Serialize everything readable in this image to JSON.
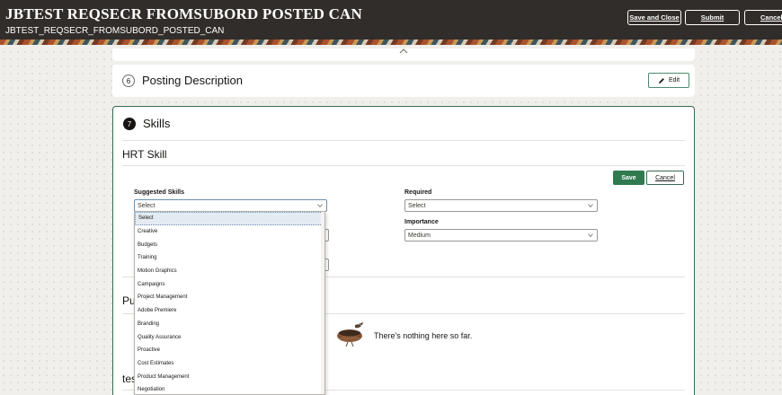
{
  "header": {
    "title": "JBTEST REQSECR FROMSUBORD POSTED CAN",
    "subtitle": "JBTEST_REQSECR_FROMSUBORD_POSTED_CAN",
    "buttons": {
      "save_close": "Save and Close",
      "submit": "Submit",
      "cancel": "Cancel"
    }
  },
  "posting_description": {
    "step": "6",
    "title": "Posting Description",
    "edit_label": "Edit"
  },
  "skills": {
    "step": "7",
    "title": "Skills",
    "section_title": "HRT Skill",
    "save_label": "Save",
    "cancel_label": "Cancel",
    "suggested_skills": {
      "label": "Suggested Skills",
      "value": "Select",
      "options": [
        "Select",
        "Creative",
        "Budgets",
        "Training",
        "Motion Graphics",
        "Campaigns",
        "Project Management",
        "Adobe Premiere",
        "Branding",
        "Quality Assurance",
        "Proactive",
        "Cost Estimates",
        "Product Management",
        "Negotiation"
      ]
    },
    "required": {
      "label": "Required",
      "value": "Select"
    },
    "importance": {
      "label": "Importance",
      "value": "Medium"
    },
    "partial_heading_1": "Pu",
    "partial_heading_2": "tes",
    "empty_state": "There's nothing here so far."
  }
}
